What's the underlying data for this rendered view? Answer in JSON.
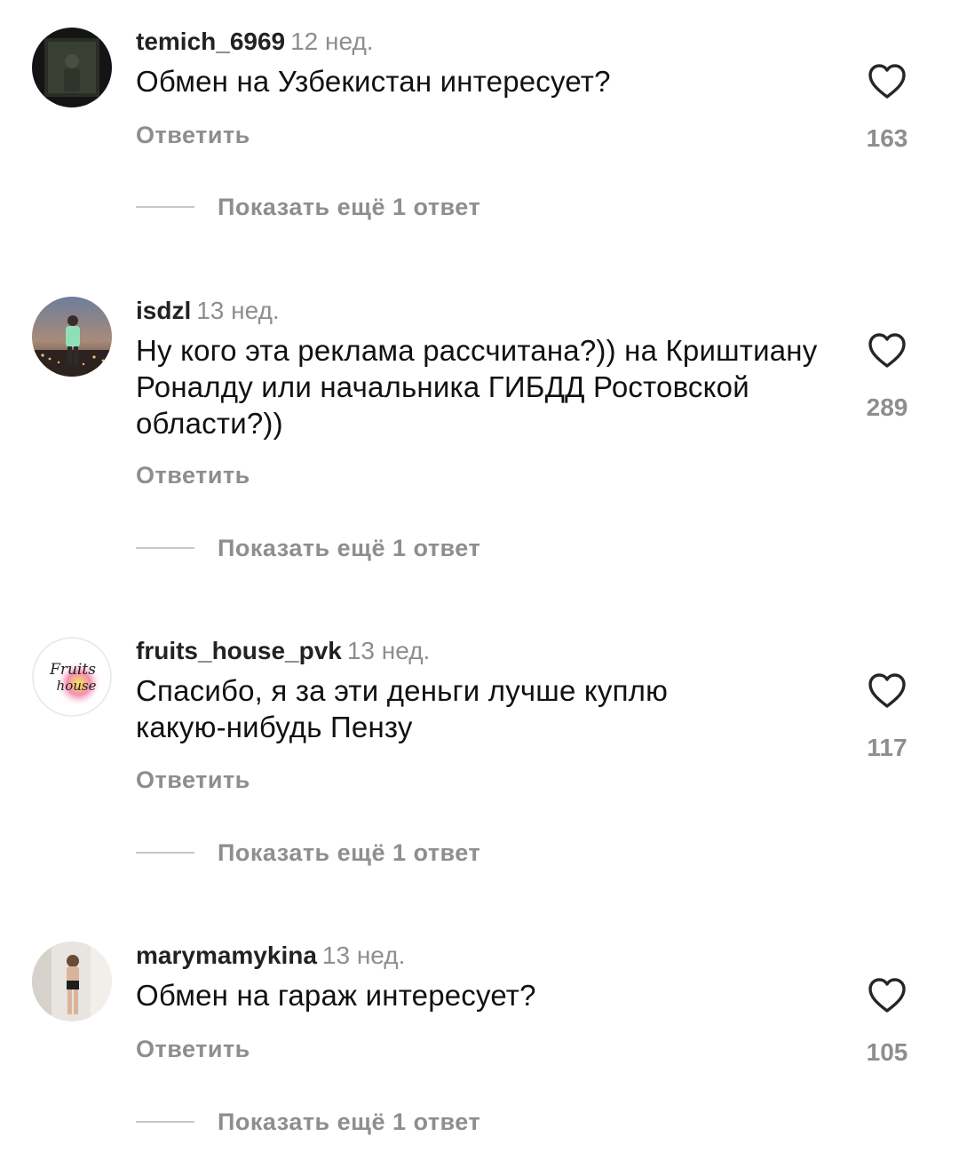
{
  "comments": [
    {
      "username": "temich_6969",
      "time": "12 нед.",
      "text": "Обмен на Узбекистан интересует?",
      "reply_label": "Ответить",
      "likes": "163",
      "show_replies": "Показать ещё 1 ответ"
    },
    {
      "username": "isdzl",
      "time": "13 нед.",
      "text": "Ну кого эта реклама рассчитана?)) на Криштиану Роналду или начальника ГИБДД Ростовской области?))",
      "reply_label": "Ответить",
      "likes": "289",
      "show_replies": "Показать ещё 1 ответ"
    },
    {
      "username": "fruits_house_pvk",
      "time": "13 нед.",
      "text": "Спасибо, я за эти деньги лучше куплю какую-нибудь Пензу",
      "reply_label": "Ответить",
      "likes": "117",
      "show_replies": "Показать ещё 1 ответ",
      "avatar_logo_text": "Fruits house"
    },
    {
      "username": "marymamykina",
      "time": "13 нед.",
      "text": "Обмен на гараж интересует?",
      "reply_label": "Ответить",
      "likes": "105",
      "show_replies": "Показать ещё 1 ответ"
    }
  ],
  "colors": {
    "text": "#111111",
    "muted": "#8e8e8e",
    "divider": "#c7c7c7",
    "icon": "#262626"
  },
  "icons": {
    "like": "heart-outline-icon"
  }
}
